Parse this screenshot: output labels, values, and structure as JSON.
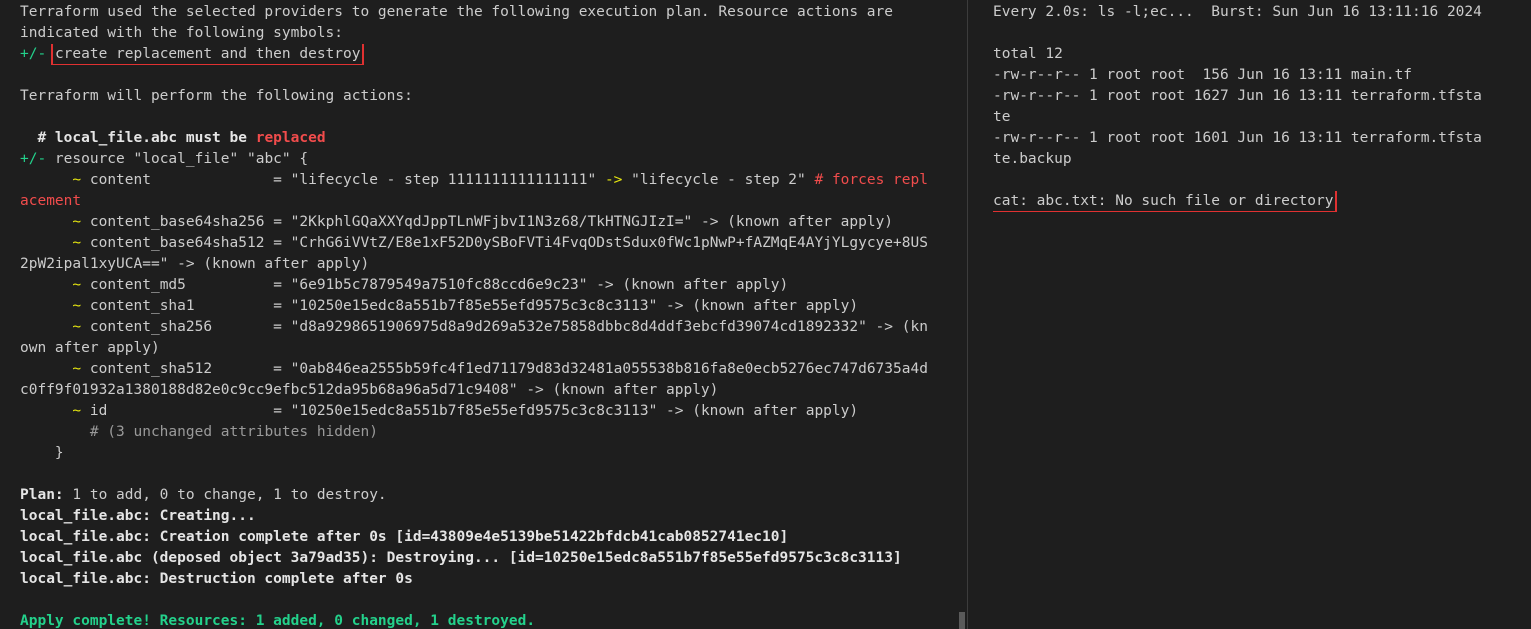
{
  "left": {
    "plan_intro_1": "Terraform used the selected providers to generate the following execution plan. Resource actions are",
    "plan_intro_2": "indicated with the following symbols:",
    "symbol": "+/-",
    "symbol_desc": "create replacement and then destroy",
    "actions_intro": "Terraform will perform the following actions:",
    "resource_comment": "  # local_file.abc",
    "resource_must_be": " must be ",
    "resource_replaced": "replaced",
    "resource_decl": " resource \"local_file\" \"abc\" {",
    "tilde": "~",
    "attributes": [
      {
        "name": "content",
        "before": "\"lifecycle - step 1111111111111111\"",
        "arrow": "->",
        "after": "\"lifecycle - step 2\"",
        "note": "# forces replacement"
      },
      {
        "name": "content_base64sha256",
        "line": "\"2KkphlGQaXXYqdJppTLnWFjbvI1N3z68/TkHTNGJIzI=\" -> (known after apply)"
      },
      {
        "name": "content_base64sha512",
        "line": "\"CrhG6iVVtZ/E8e1xF52D0ySBoFVTi4FvqODstSdux0fWc1pNwP+fAZMqE4AYjYLgycye+8US",
        "wrap": "2pW2ipal1xyUCA==\" -> (known after apply)"
      },
      {
        "name": "content_md5",
        "line": "\"6e91b5c7879549a7510fc88ccd6e9c23\" -> (known after apply)"
      },
      {
        "name": "content_sha1",
        "line": "\"10250e15edc8a551b7f85e55efd9575c3c8c3113\" -> (known after apply)"
      },
      {
        "name": "content_sha256",
        "line": "\"d8a9298651906975d8a9d269a532e75858dbbc8d4ddf3ebcfd39074cd1892332\" -> (kn",
        "wrap": "own after apply)"
      },
      {
        "name": "content_sha512",
        "line": "\"0ab846ea2555b59fc4f1ed71179d83d32481a055538b816fa8e0ecb5276ec747d6735a4d",
        "wrap": "c0ff9f01932a1380188d82e0c9cc9efbc512da95b68a96a5d71c9408\" -> (known after apply)"
      },
      {
        "name": "id",
        "line": "\"10250e15edc8a551b7f85e55efd9575c3c8c3113\" -> (known after apply)"
      }
    ],
    "hidden_note": "# (3 unchanged attributes hidden)",
    "close_brace": "}",
    "plan_label": "Plan:",
    "plan_text": " 1 to add, 0 to change, 1 to destroy.",
    "log_lines": [
      "local_file.abc: Creating...",
      "local_file.abc: Creation complete after 0s [id=43809e4e5139be51422bfdcb41cab0852741ec10]",
      "local_file.abc (deposed object 3a79ad35): Destroying... [id=10250e15edc8a551b7f85e55efd9575c3c8c3113]",
      "local_file.abc: Destruction complete after 0s"
    ],
    "apply_complete": "Apply complete! Resources: 1 added, 0 changed, 1 destroyed."
  },
  "right": {
    "watch_header": "Every 2.0s: ls -l;ec...  Burst: Sun Jun 16 13:11:16 2024",
    "total": "total 12",
    "listing": [
      "-rw-r--r-- 1 root root  156 Jun 16 13:11 main.tf",
      "-rw-r--r-- 1 root root 1627 Jun 16 13:11 terraform.tfsta",
      "te",
      "-rw-r--r-- 1 root root 1601 Jun 16 13:11 terraform.tfsta",
      "te.backup"
    ],
    "cat_error": "cat: abc.txt: No such file or directory"
  },
  "colors": {
    "background": "#1e1e1e",
    "green": "#23d18b",
    "yellow": "#e5e510",
    "red": "#f14c4c",
    "highlight_box": "#e03131"
  }
}
